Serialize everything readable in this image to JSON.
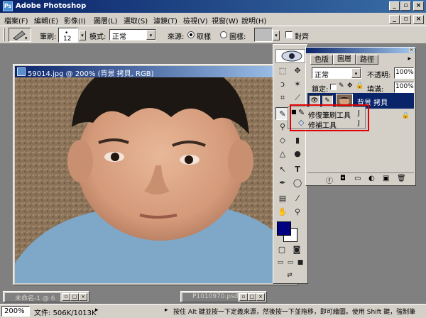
{
  "app": {
    "title": "Adobe Photoshop"
  },
  "menu": [
    "檔案(F)",
    "編輯(E)",
    "影像(I)",
    "圖層(L)",
    "選取(S)",
    "濾鏡(T)",
    "檢視(V)",
    "視窗(W)",
    "說明(H)"
  ],
  "options": {
    "brush_label": "筆刷:",
    "brush_size": "12",
    "mode_label": "模式:",
    "mode_value": "正常",
    "source_label": "來源:",
    "source_sampled": "取樣",
    "source_pattern": "圖樣:",
    "aligned_label": "對齊"
  },
  "document": {
    "title": "59014.jpg @ 200% (背景 拷貝, RGB)"
  },
  "palette": {
    "tabs": [
      "色版",
      "圖層",
      "路徑"
    ],
    "blend_mode": "正常",
    "opacity_label": "不透明:",
    "opacity_value": "100%",
    "lock_label": "鎖定:",
    "fill_label": "填滿:",
    "fill_value": "100%",
    "layer_name": "背景 拷貝"
  },
  "flyout": {
    "items": [
      {
        "label": "修復筆刷工具",
        "shortcut": "J"
      },
      {
        "label": "修補工具",
        "shortcut": "J"
      }
    ]
  },
  "minimized": {
    "win1": "未命名-1 @ 6",
    "win2": "P1010970.psd"
  },
  "status": {
    "zoom": "200%",
    "doc_info": "文件: 506K/1013K",
    "hint": "按住 Alt 鍵並按一下定義來源，然後按一下並拖移，即可繪圖。使用 Shift 鍵，強制筆"
  },
  "colors": {
    "foreground": "#000080",
    "background": "#ffffff",
    "selected_layer": "#0a246a",
    "highlight": "#e00000"
  }
}
